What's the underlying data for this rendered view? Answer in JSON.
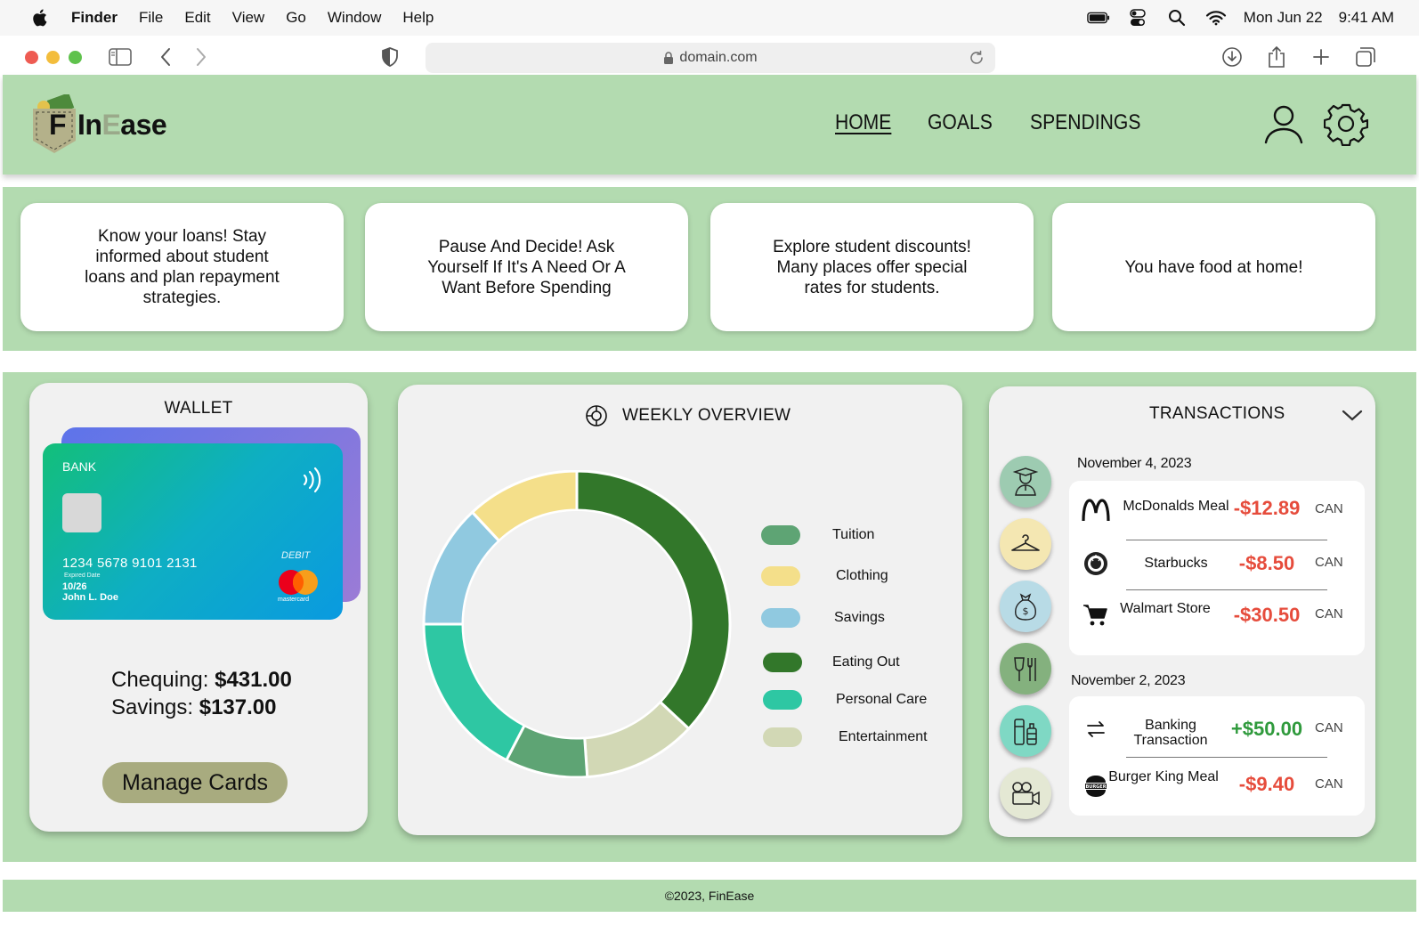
{
  "menubar": {
    "app": "Finder",
    "items": [
      "File",
      "Edit",
      "View",
      "Go",
      "Window",
      "Help"
    ],
    "date": "Mon Jun 22",
    "time": "9:41 AM"
  },
  "browser": {
    "url": "domain.com"
  },
  "header": {
    "logo_f": "F",
    "logo_in": "In",
    "logo_e": "E",
    "logo_ase": "ase",
    "nav": [
      "HOME",
      "GOALS",
      "SPENDINGS"
    ],
    "active_nav": "HOME"
  },
  "tips": [
    "Know your loans! Stay informed about student loans and plan repayment strategies.",
    "Pause And Decide! Ask Yourself If It's A Need Or A Want Before Spending",
    "Explore student discounts! Many places offer special rates for students.",
    "You have food at home!"
  ],
  "wallet": {
    "title": "WALLET",
    "card": {
      "bank": "BANK",
      "number": "1234 5678 9101 2131",
      "expiry_label": "Expired Date",
      "expiry": "10/26",
      "holder": "John L. Doe",
      "type": "DEBIT",
      "network": "mastercard"
    },
    "chequing_label": "Chequing:",
    "chequing_value": "$431.00",
    "savings_label": "Savings:",
    "savings_value": "$137.00",
    "manage_button": "Manage Cards"
  },
  "weekly": {
    "title": "WEEKLY OVERVIEW",
    "legend": [
      {
        "label": "Tuition",
        "color": "#5ea474"
      },
      {
        "label": "Clothing",
        "color": "#f4df8a"
      },
      {
        "label": "Savings",
        "color": "#90c9e0"
      },
      {
        "label": "Eating Out",
        "color": "#32772a"
      },
      {
        "label": "Personal Care",
        "color": "#2ec7a3"
      },
      {
        "label": "Entertainment",
        "color": "#d2d8b5"
      }
    ]
  },
  "chart_data": {
    "type": "pie",
    "categories": [
      "Eating Out",
      "Entertainment",
      "Tuition",
      "Personal Care",
      "Savings",
      "Clothing"
    ],
    "values": [
      34,
      11,
      8,
      16,
      12,
      11
    ],
    "colors": [
      "#32772a",
      "#d2d8b5",
      "#5ea474",
      "#2ec7a3",
      "#90c9e0",
      "#f4df8a"
    ],
    "title": "WEEKLY OVERVIEW"
  },
  "transactions": {
    "title": "TRANSACTIONS",
    "categories": [
      {
        "icon": "graduate-icon",
        "color": "#9dcbb1"
      },
      {
        "icon": "hanger-icon",
        "color": "#f4e7b2"
      },
      {
        "icon": "money-bag-icon",
        "color": "#b8dbe6"
      },
      {
        "icon": "dining-icon",
        "color": "#84b17e"
      },
      {
        "icon": "toiletries-icon",
        "color": "#7fd8c4"
      },
      {
        "icon": "camera-icon",
        "color": "#e4e8d4"
      }
    ],
    "groups": [
      {
        "date": "November 4, 2023",
        "items": [
          {
            "name": "McDonalds Meal",
            "amount": "-$12.89",
            "currency": "CAN",
            "logo": "mcdonalds-logo-icon"
          },
          {
            "name": "Starbucks",
            "amount": "-$8.50",
            "currency": "CAN",
            "logo": "starbucks-logo-icon"
          },
          {
            "name": "Walmart Store",
            "amount": "-$30.50",
            "currency": "CAN",
            "logo": "cart-icon"
          }
        ]
      },
      {
        "date": "November 2, 2023",
        "items": [
          {
            "name": "Banking Transaction",
            "amount": "+$50.00",
            "currency": "CAN",
            "logo": "transfer-icon"
          },
          {
            "name": "Burger King Meal",
            "amount": "-$9.40",
            "currency": "CAN",
            "logo": "burger-king-logo-icon"
          }
        ]
      }
    ]
  },
  "footer": {
    "text": "©2023, FinEase"
  }
}
